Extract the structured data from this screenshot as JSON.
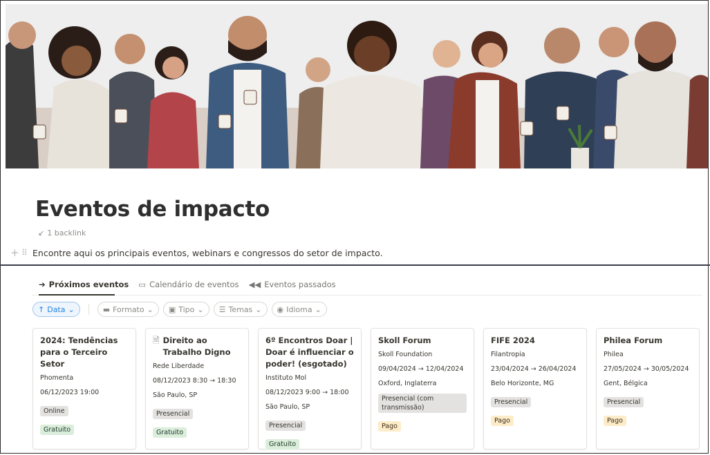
{
  "page": {
    "title": "Eventos de impacto",
    "backlink": "1 backlink",
    "description": "Encontre aqui os principais eventos, webinars e congressos do setor de impacto."
  },
  "tabs": [
    {
      "label": "Próximos eventos",
      "icon": "arrow-circle-icon",
      "active": true
    },
    {
      "label": "Calendário de eventos",
      "icon": "calendar-icon",
      "active": false
    },
    {
      "label": "Eventos passados",
      "icon": "rewind-icon",
      "active": false
    }
  ],
  "filters": {
    "sort": "Data",
    "chips": [
      "Formato",
      "Tipo",
      "Temas",
      "Idioma"
    ]
  },
  "cards": [
    {
      "title": "2024: Tendências para o Terceiro Setor",
      "org": "Phomenta",
      "date": "06/12/2023 19:00",
      "location": "",
      "format": "Online",
      "price": "Gratuito"
    },
    {
      "title": "Direito ao Trabalho Digno",
      "org": "Rede Liberdade",
      "date": "08/12/2023 8:30 → 18:30",
      "location": "São Paulo, SP",
      "format": "Presencial",
      "price": "Gratuito"
    },
    {
      "title": "6º Encontros Doar | Doar é influenciar o poder! (esgotado)",
      "org": "Instituto Mol",
      "date": "08/12/2023 9:00 → 18:00",
      "location": "São Paulo, SP",
      "format": "Presencial",
      "price": "Gratuito"
    },
    {
      "title": "Skoll Forum",
      "org": "Skoll Foundation",
      "date": "09/04/2024 → 12/04/2024",
      "location": "Oxford, Inglaterra",
      "format": "Presencial (com transmissão)",
      "price": "Pago"
    },
    {
      "title": "FIFE 2024",
      "org": "Filantropia",
      "date": "23/04/2024 → 26/04/2024",
      "location": "Belo Horizonte, MG",
      "format": "Presencial",
      "price": "Pago"
    },
    {
      "title": "Philea Forum",
      "org": "Philea",
      "date": "27/05/2024 → 30/05/2024",
      "location": "Gent, Bélgica",
      "format": "Presencial",
      "price": "Pago"
    }
  ]
}
